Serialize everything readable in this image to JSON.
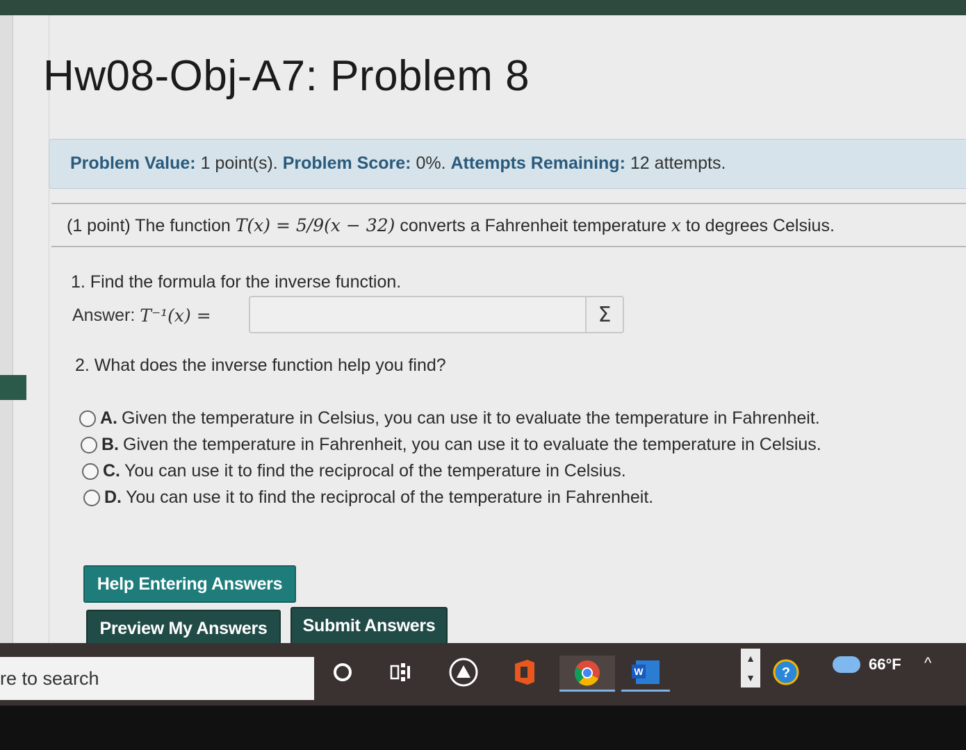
{
  "page": {
    "title": "Hw08-Obj-A7: Problem 8"
  },
  "info": {
    "value_label": "Problem Value:",
    "value_text": "1 point(s).",
    "score_label": "Problem Score:",
    "score_text": "0%.",
    "attempts_label": "Attempts Remaining:",
    "attempts_text": "12 attempts."
  },
  "problem": {
    "statement_prefix": "(1 point) The function",
    "statement_func": "T(x) = 5/9(x − 32)",
    "statement_mid": "converts a Fahrenheit temperature",
    "statement_var": "x",
    "statement_suffix": "to degrees Celsius.",
    "q1": "1. Find the formula for the inverse function.",
    "answer_label": "Answer:",
    "answer_expr": "T⁻¹(x) =",
    "answer_value": "",
    "sigma": "Σ",
    "q2": "2. What does the inverse function help you find?",
    "options": [
      {
        "letter": "A.",
        "text": "Given the temperature in Celsius, you can use it to evaluate the temperature in Fahrenheit."
      },
      {
        "letter": "B.",
        "text": "Given the temperature in Fahrenheit, you can use it to evaluate the temperature in Celsius."
      },
      {
        "letter": "C.",
        "text": "You can use it to find the reciprocal of the temperature in Celsius."
      },
      {
        "letter": "D.",
        "text": "You can use it to find the reciprocal of the temperature in Fahrenheit."
      }
    ]
  },
  "buttons": {
    "help": "Help Entering Answers",
    "preview": "Preview My Answers",
    "submit": "Submit Answers"
  },
  "taskbar": {
    "search_text": "re to search",
    "weather": "66°F",
    "word_letter": "W",
    "help_glyph": "?",
    "caret": "^"
  }
}
